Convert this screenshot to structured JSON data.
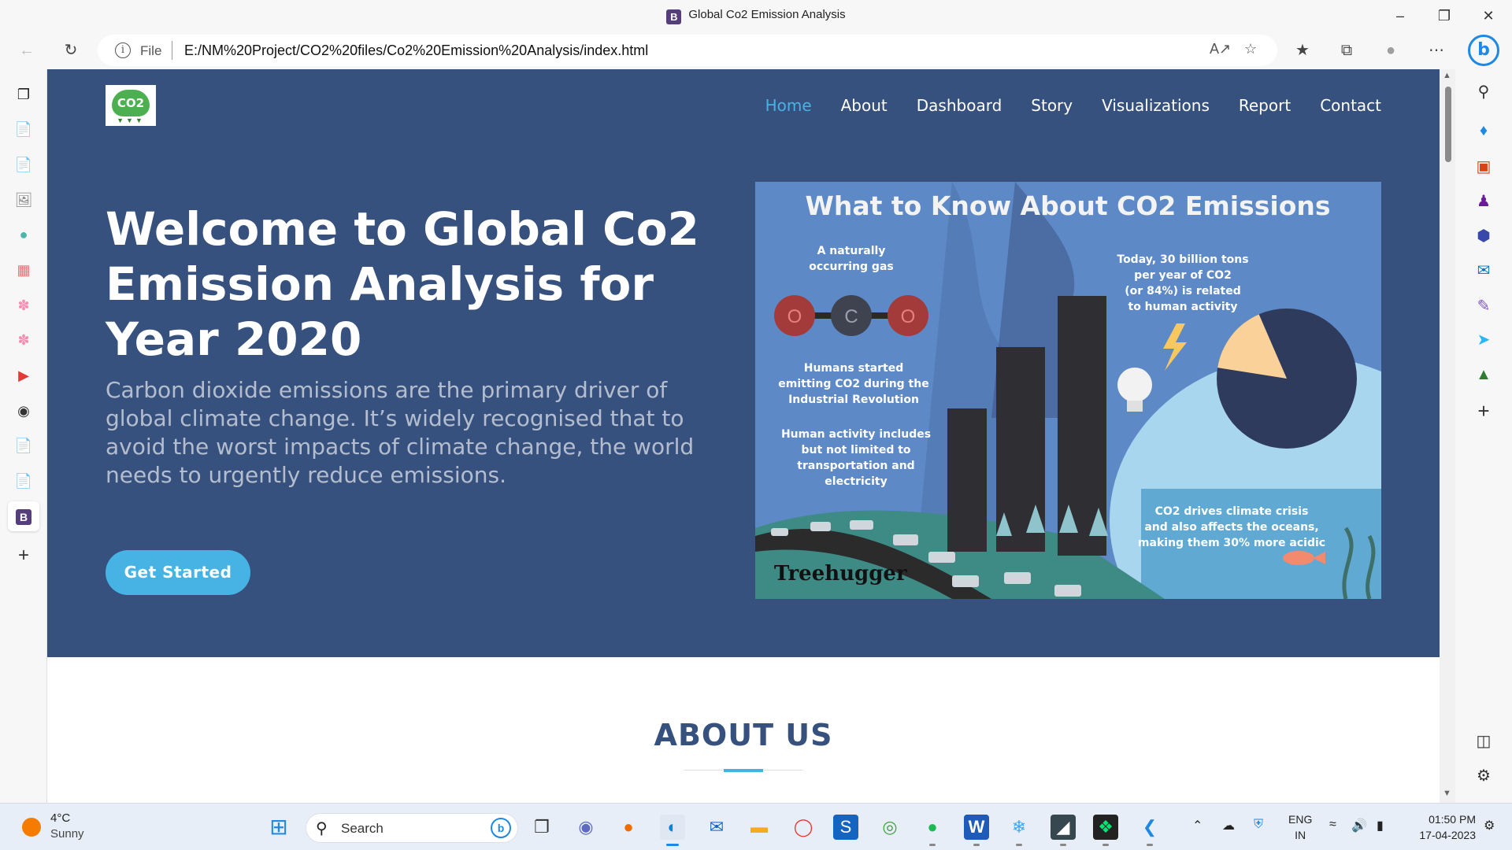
{
  "browser": {
    "window_title": "Global Co2 Emission Analysis",
    "favicon_letter": "B",
    "address": {
      "scheme_label": "File",
      "url": "E:/NM%20Project/CO2%20files/Co2%20Emission%20Analysis/index.html"
    },
    "active_tab_letter": "B",
    "bing_letter": "b"
  },
  "site": {
    "logo_text": "CO2",
    "nav": [
      "Home",
      "About",
      "Dashboard",
      "Story",
      "Visualizations",
      "Report",
      "Contact"
    ],
    "active_nav": "Home",
    "hero": {
      "title": "Welcome to Global Co2 Emission Analysis for Year 2020",
      "subtitle": "Carbon dioxide emissions are the primary driver of global climate change. It’s widely recognised that to avoid the worst impacts of climate change, the world needs to urgently reduce emissions.",
      "cta_label": "Get Started"
    },
    "infographic": {
      "title": "What to Know About CO2 Emissions",
      "text_natural": [
        "A naturally",
        "occurring gas"
      ],
      "molecule": [
        "O",
        "C",
        "O"
      ],
      "text_humans_started": [
        "Humans started",
        "emitting CO2 during the",
        "Industrial Revolution"
      ],
      "text_activity": [
        "Human activity includes",
        "but not limited to",
        "transportation and",
        "electricity"
      ],
      "text_today": [
        "Today, 30 billion tons",
        "per year of CO2",
        "(or 84%) is related",
        "to human activity"
      ],
      "text_oceans": [
        "CO2 drives climate crisis",
        "and also affects the oceans,",
        "making them 30% more acidic"
      ],
      "brand": "Treehugger",
      "pie_human_share": 0.16
    },
    "about_title": "ABOUT US"
  },
  "taskbar": {
    "weather_temp": "4°C",
    "weather_desc": "Sunny",
    "search_label": "Search",
    "lang_line1": "ENG",
    "lang_line2": "IN",
    "time": "01:50 PM",
    "date": "17-04-2023"
  },
  "colors": {
    "hero_bg": "#37517e",
    "accent": "#47b2e4",
    "chrome_bg": "#f7f7f7"
  }
}
